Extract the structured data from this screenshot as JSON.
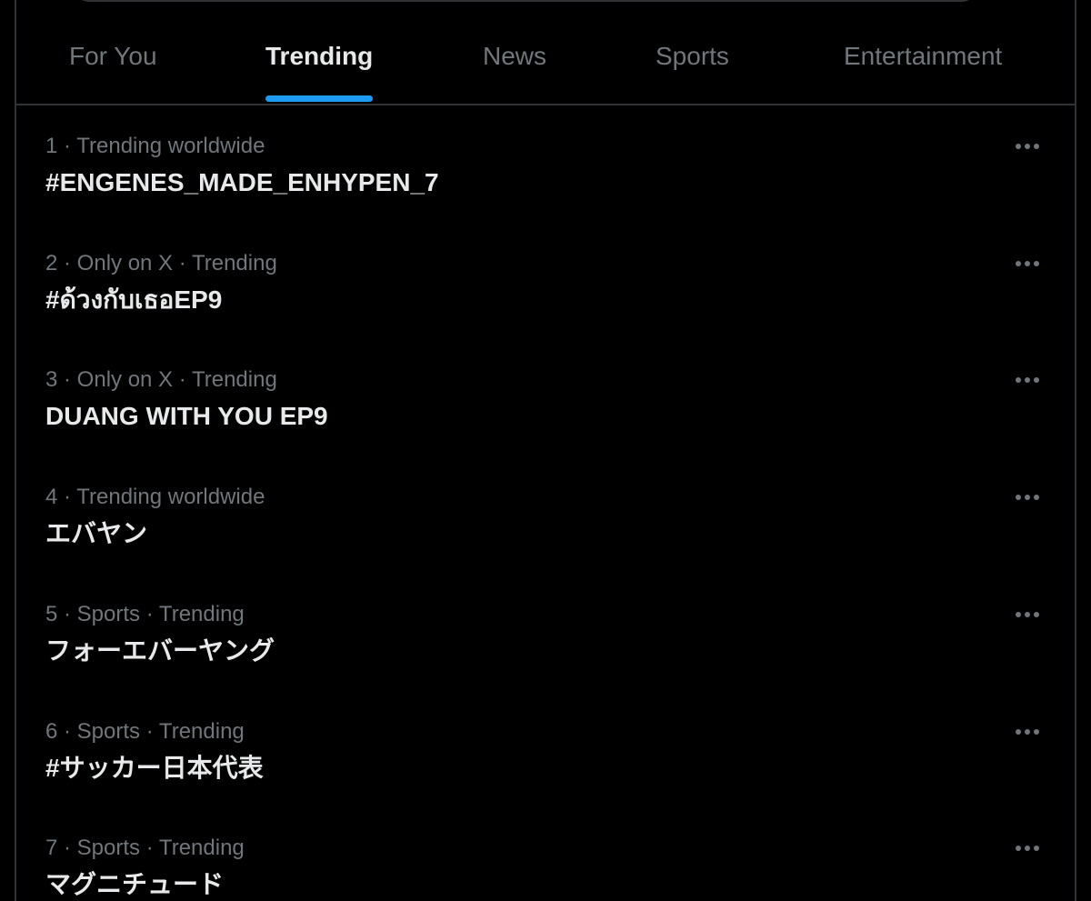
{
  "tabs": [
    {
      "label": "For You",
      "active": false
    },
    {
      "label": "Trending",
      "active": true
    },
    {
      "label": "News",
      "active": false
    },
    {
      "label": "Sports",
      "active": false
    },
    {
      "label": "Entertainment",
      "active": false
    }
  ],
  "trends": [
    {
      "meta": "1 · Trending worldwide",
      "name": "#ENGENES_MADE_ENHYPEN_7"
    },
    {
      "meta": "2 · Only on X · Trending",
      "name": "#ด้วงกับเธอEP9"
    },
    {
      "meta": "3 · Only on X · Trending",
      "name": "DUANG WITH YOU EP9"
    },
    {
      "meta": "4 · Trending worldwide",
      "name": "エバヤン"
    },
    {
      "meta": "5 · Sports · Trending",
      "name": "フォーエバーヤング"
    },
    {
      "meta": "6 · Sports · Trending",
      "name": "#サッカー日本代表"
    },
    {
      "meta": "7 · Sports · Trending",
      "name": "マグニチュード"
    }
  ],
  "icons": {
    "more": "more-horizontal-icon"
  },
  "colors": {
    "background": "#000000",
    "text_primary": "#e7e9ea",
    "text_secondary": "#71767b",
    "accent": "#1d9bf0",
    "border": "#2f3336"
  }
}
